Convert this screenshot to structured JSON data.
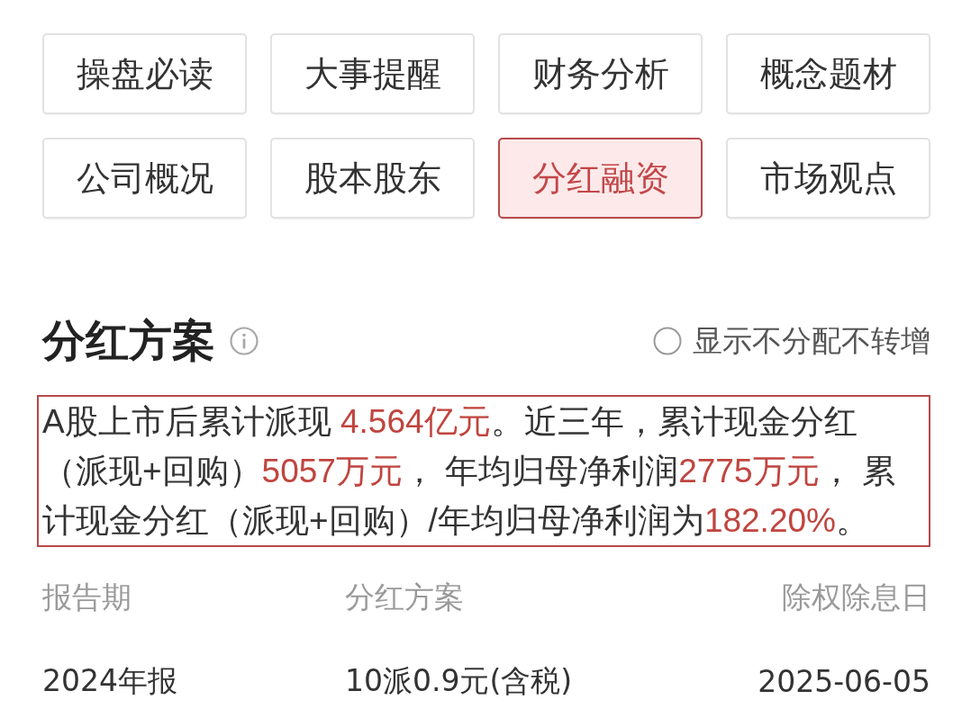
{
  "tabs": [
    {
      "label": "操盘必读",
      "selected": false
    },
    {
      "label": "大事提醒",
      "selected": false
    },
    {
      "label": "财务分析",
      "selected": false
    },
    {
      "label": "概念题材",
      "selected": false
    },
    {
      "label": "公司概况",
      "selected": false
    },
    {
      "label": "股本股东",
      "selected": false
    },
    {
      "label": "分红融资",
      "selected": true
    },
    {
      "label": "市场观点",
      "selected": false
    }
  ],
  "section": {
    "title": "分红方案",
    "filter_option": {
      "label": "显示不分配不转增",
      "checked": false
    }
  },
  "summary": {
    "segments": [
      {
        "text": "A股上市后累计派现 ",
        "highlight": false
      },
      {
        "text": "4.564亿元",
        "highlight": true
      },
      {
        "text": "。近三年，累计现金分红（派现+回购）",
        "highlight": false
      },
      {
        "text": "5057万元",
        "highlight": true
      },
      {
        "text": "， 年均归母净利润",
        "highlight": false
      },
      {
        "text": "2775万元",
        "highlight": true
      },
      {
        "text": "， 累计现金分红（派现+回购）/年均归母净利润为",
        "highlight": false
      },
      {
        "text": "182.20%",
        "highlight": true
      },
      {
        "text": "。",
        "highlight": false
      }
    ]
  },
  "dividend_table": {
    "columns": [
      "报告期",
      "分红方案",
      "除权除息日"
    ],
    "rows": [
      {
        "cells": [
          "2024年报",
          "10派0.9元(含税)",
          "2025-06-05"
        ]
      }
    ]
  }
}
